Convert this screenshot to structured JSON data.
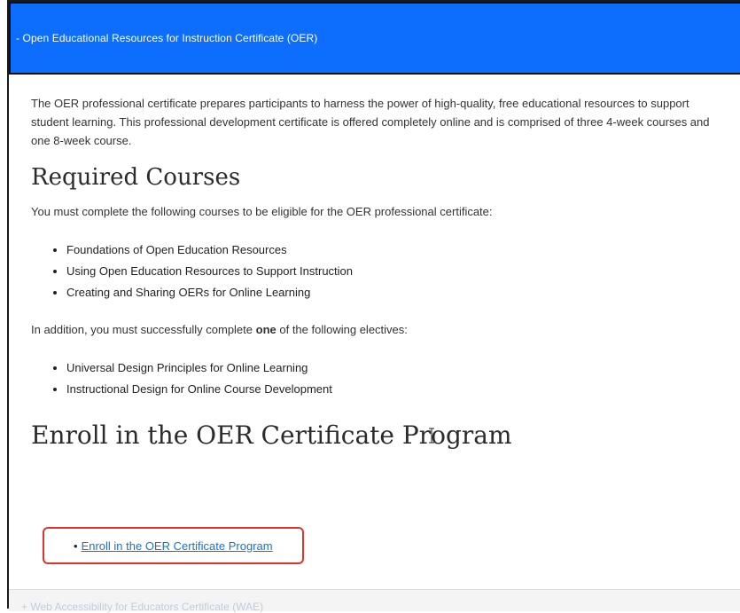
{
  "accordion": {
    "header_label": "- Open Educational Resources for Instruction Certificate (OER)"
  },
  "intro": {
    "text": "The OER professional certificate prepares participants to harness the power of high-quality, free educational resources to support student learning. This professional development certificate is offered completely online and is comprised of three 4-week courses and one 8-week course."
  },
  "required": {
    "heading": "Required Courses",
    "description": "You must complete the following courses to be eligible for the OER professional certificate:",
    "courses": [
      "Foundations of Open Education Resources",
      "Using Open Education Resources to Support Instruction",
      "Creating and Sharing OERs for Online Learning"
    ]
  },
  "electives": {
    "text_before": "In addition, you must successfully complete ",
    "emphasis": "one",
    "text_after": " of the following electives:",
    "courses": [
      "Universal Design Principles for Online Learning",
      "Instructional Design for Online Course Development"
    ]
  },
  "enroll": {
    "heading": "Enroll in the OER Certificate Program",
    "link_label": "Enroll in the OER Certificate Program"
  },
  "footer": {
    "partial_text": "+ Web Accessibility for Educators Certificate (WAE)"
  },
  "colors": {
    "header_bg": "#0d6efd",
    "link": "#1a73c8",
    "highlight": "#e0342b"
  }
}
